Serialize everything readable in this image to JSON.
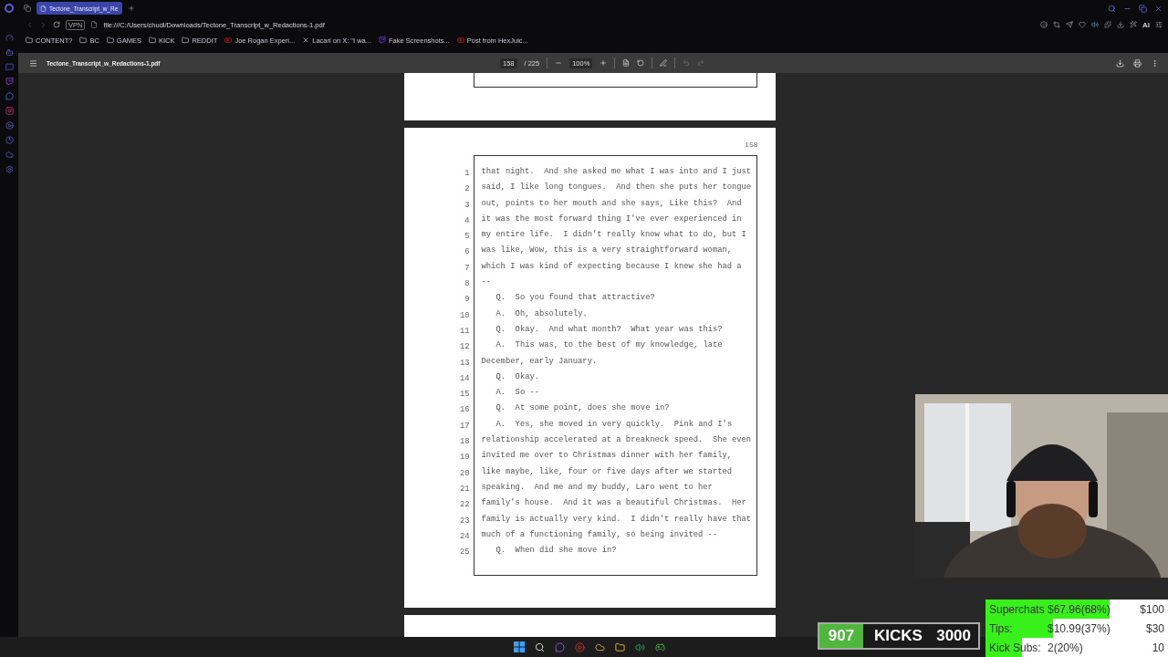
{
  "browser": {
    "tab_title": "Tectone_Transcript_w_Re",
    "vpn_badge": "VPN",
    "address": "file:///C:/Users/chudi/Downloads/Tectone_Transcript_w_Redactions-1.pdf",
    "ai_label": "AI",
    "bookmarks": [
      {
        "label": "CONTENT?",
        "kind": "folder"
      },
      {
        "label": "BC",
        "kind": "folder"
      },
      {
        "label": "GAMES",
        "kind": "folder"
      },
      {
        "label": "KICK",
        "kind": "folder"
      },
      {
        "label": "REDDIT",
        "kind": "folder"
      },
      {
        "label": "Joe Rogan Experi...",
        "kind": "video"
      },
      {
        "label": "Lacari on X: \"I wa...",
        "kind": "x"
      },
      {
        "label": "Fake Screenshots...",
        "kind": "stream"
      },
      {
        "label": "Post from HexJuic...",
        "kind": "video"
      }
    ]
  },
  "pdf": {
    "file_name": "Tectone_Transcript_w_Redactions-1.pdf",
    "page": "158",
    "page_count": "/ 225",
    "zoom": "100%",
    "page_number": "158",
    "lines": [
      {
        "number": "1",
        "text": "that night.  And she asked me what I was into and I just",
        "indented": false
      },
      {
        "number": "2",
        "text": "said, I like long tongues.  And then she puts her tongue",
        "indented": false
      },
      {
        "number": "3",
        "text": "out, points to her mouth and she says, Like this?  And",
        "indented": false
      },
      {
        "number": "4",
        "text": "it was the most forward thing I've ever experienced in",
        "indented": false
      },
      {
        "number": "5",
        "text": "my entire life.  I didn't really know what to do, but I",
        "indented": false
      },
      {
        "number": "6",
        "text": "was like, Wow, this is a very straightforward woman,",
        "indented": false
      },
      {
        "number": "7",
        "text": "which I was kind of expecting because I knew she had a",
        "indented": false
      },
      {
        "number": "8",
        "text": "--",
        "indented": false
      },
      {
        "number": "9",
        "text": "Q.  So you found that attractive?",
        "indented": true
      },
      {
        "number": "10",
        "text": "A.  Oh, absolutely.",
        "indented": true
      },
      {
        "number": "11",
        "text": "Q.  Okay.  And what month?  What year was this?",
        "indented": true
      },
      {
        "number": "12",
        "text": "A.  This was, to the best of my knowledge, late",
        "indented": true
      },
      {
        "number": "13",
        "text": "December, early January.",
        "indented": false
      },
      {
        "number": "14",
        "text": "Q.  Okay.",
        "indented": true
      },
      {
        "number": "15",
        "text": "A.  So --",
        "indented": true
      },
      {
        "number": "16",
        "text": "Q.  At some point, does she move in?",
        "indented": true
      },
      {
        "number": "17",
        "text": "A.  Yes, she moved in very quickly.  Pink and I's",
        "indented": true
      },
      {
        "number": "18",
        "text": "relationship accelerated at a breakneck speed.  She even",
        "indented": false
      },
      {
        "number": "19",
        "text": "invited me over to Christmas dinner with her family,",
        "indented": false
      },
      {
        "number": "20",
        "text": "like maybe, like, four or five days after we started",
        "indented": false
      },
      {
        "number": "21",
        "text": "speaking.  And me and my buddy, Laro went to her",
        "indented": false
      },
      {
        "number": "22",
        "text": "family's house.  And it was a beautiful Christmas.  Her",
        "indented": false
      },
      {
        "number": "23",
        "text": "family is actually very kind.  I didn't really have that",
        "indented": false
      },
      {
        "number": "24",
        "text": "much of a functioning family, so being invited --",
        "indented": false
      },
      {
        "number": "25",
        "text": "Q.  When did she move in?",
        "indented": true
      }
    ]
  },
  "overlay": {
    "kicks": {
      "current": "907",
      "label": "KICKS",
      "target": "3000"
    },
    "goals": [
      {
        "label": "Superchats",
        "amount": "$67.96(68%)",
        "target": "$100",
        "level": 0.68
      },
      {
        "label": "Tips:",
        "amount": "$10.99(37%)",
        "target": "$30",
        "level": 0.37
      },
      {
        "label": "Kick Subs:",
        "amount": "2(20%)",
        "target": "10",
        "level": 0.2
      }
    ]
  }
}
